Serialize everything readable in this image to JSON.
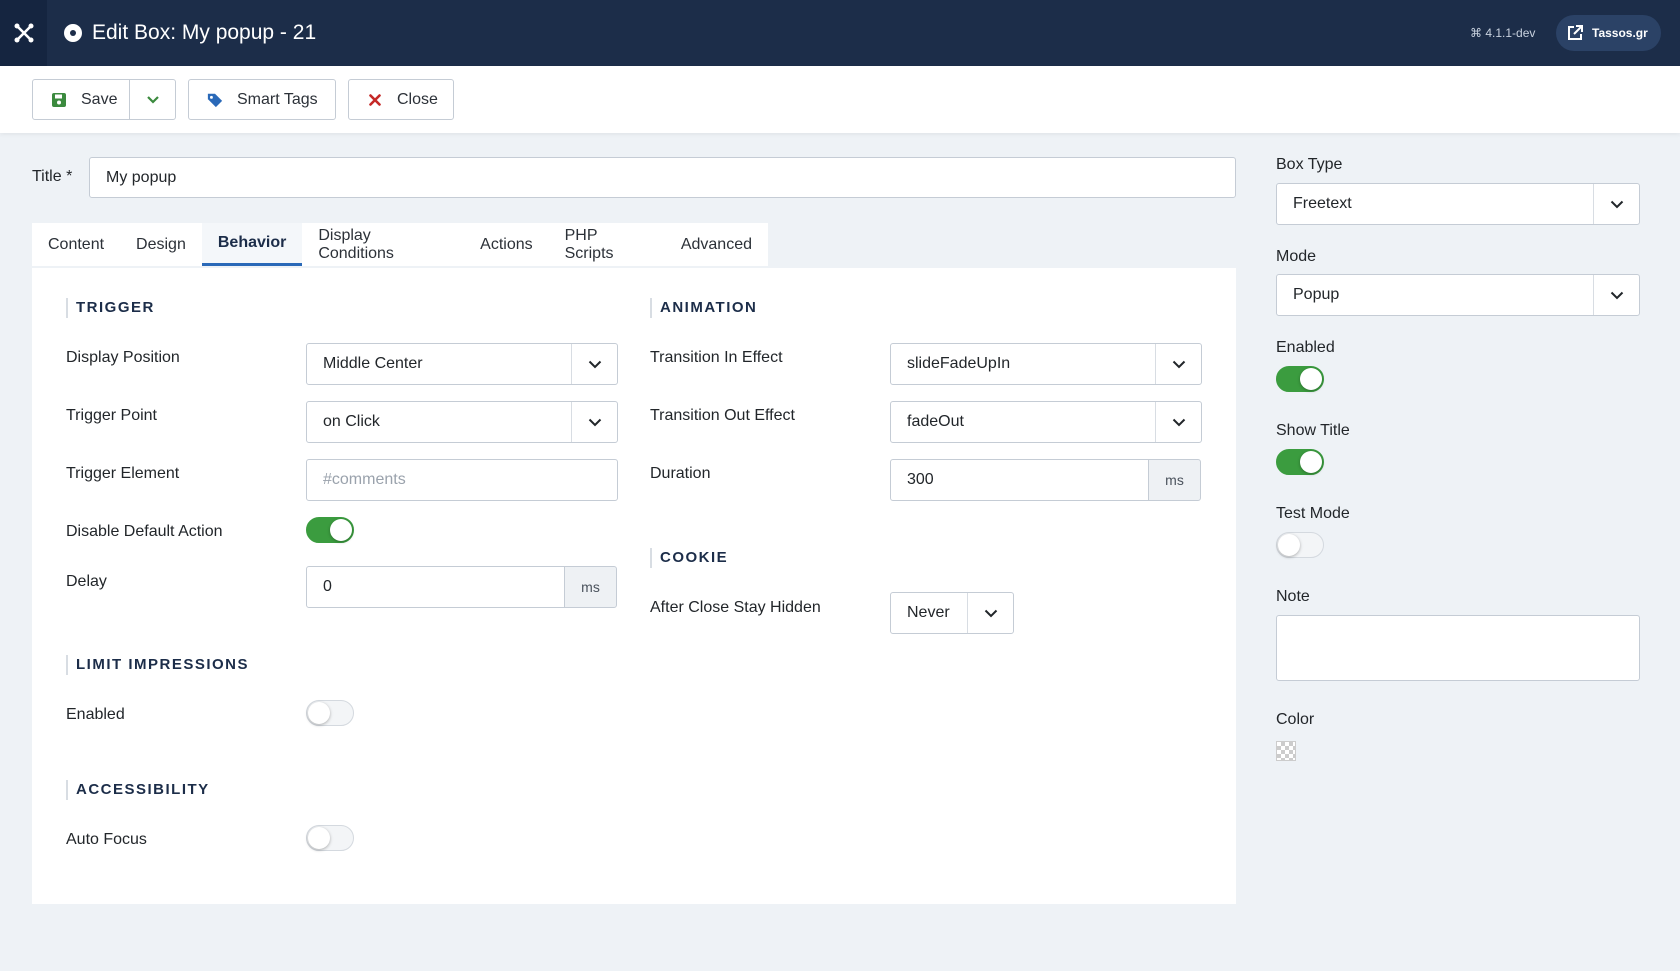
{
  "header": {
    "title": "Edit Box: My popup - 21",
    "version": "⌘ 4.1.1-dev",
    "site_label": "Tassos.gr"
  },
  "toolbar": {
    "save_label": "Save",
    "smart_tags_label": "Smart Tags",
    "close_label": "Close"
  },
  "title_field": {
    "label": "Title *",
    "value": "My popup"
  },
  "tabs": [
    {
      "label": "Content"
    },
    {
      "label": "Design"
    },
    {
      "label": "Behavior",
      "active": true
    },
    {
      "label": "Display Conditions"
    },
    {
      "label": "Actions"
    },
    {
      "label": "PHP Scripts"
    },
    {
      "label": "Advanced"
    }
  ],
  "trigger": {
    "heading": "TRIGGER",
    "display_position": {
      "label": "Display Position",
      "value": "Middle Center"
    },
    "trigger_point": {
      "label": "Trigger Point",
      "value": "on Click"
    },
    "trigger_element": {
      "label": "Trigger Element",
      "placeholder": "#comments"
    },
    "disable_default_action": {
      "label": "Disable Default Action",
      "on": true
    },
    "delay": {
      "label": "Delay",
      "value": "0",
      "unit": "ms"
    }
  },
  "limit_impressions": {
    "heading": "LIMIT IMPRESSIONS",
    "enabled": {
      "label": "Enabled",
      "on": false
    }
  },
  "accessibility": {
    "heading": "ACCESSIBILITY",
    "auto_focus": {
      "label": "Auto Focus",
      "on": false
    }
  },
  "animation": {
    "heading": "ANIMATION",
    "transition_in": {
      "label": "Transition In Effect",
      "value": "slideFadeUpIn"
    },
    "transition_out": {
      "label": "Transition Out Effect",
      "value": "fadeOut"
    },
    "duration": {
      "label": "Duration",
      "value": "300",
      "unit": "ms"
    }
  },
  "cookie": {
    "heading": "COOKIE",
    "after_close": {
      "label": "After Close Stay Hidden",
      "value": "Never"
    }
  },
  "sidebar": {
    "box_type": {
      "label": "Box Type",
      "value": "Freetext"
    },
    "mode": {
      "label": "Mode",
      "value": "Popup"
    },
    "enabled": {
      "label": "Enabled",
      "on": true
    },
    "show_title": {
      "label": "Show Title",
      "on": true
    },
    "test_mode": {
      "label": "Test Mode",
      "on": false
    },
    "note": {
      "label": "Note",
      "value": ""
    },
    "color": {
      "label": "Color"
    }
  },
  "colors": {
    "header_bg": "#1c2d49",
    "toggle_on": "#3b9c3f",
    "tab_accent": "#2a69b8",
    "save_icon": "#3b8a3e",
    "tag_icon": "#2a69b8",
    "close_icon": "#c52827"
  }
}
